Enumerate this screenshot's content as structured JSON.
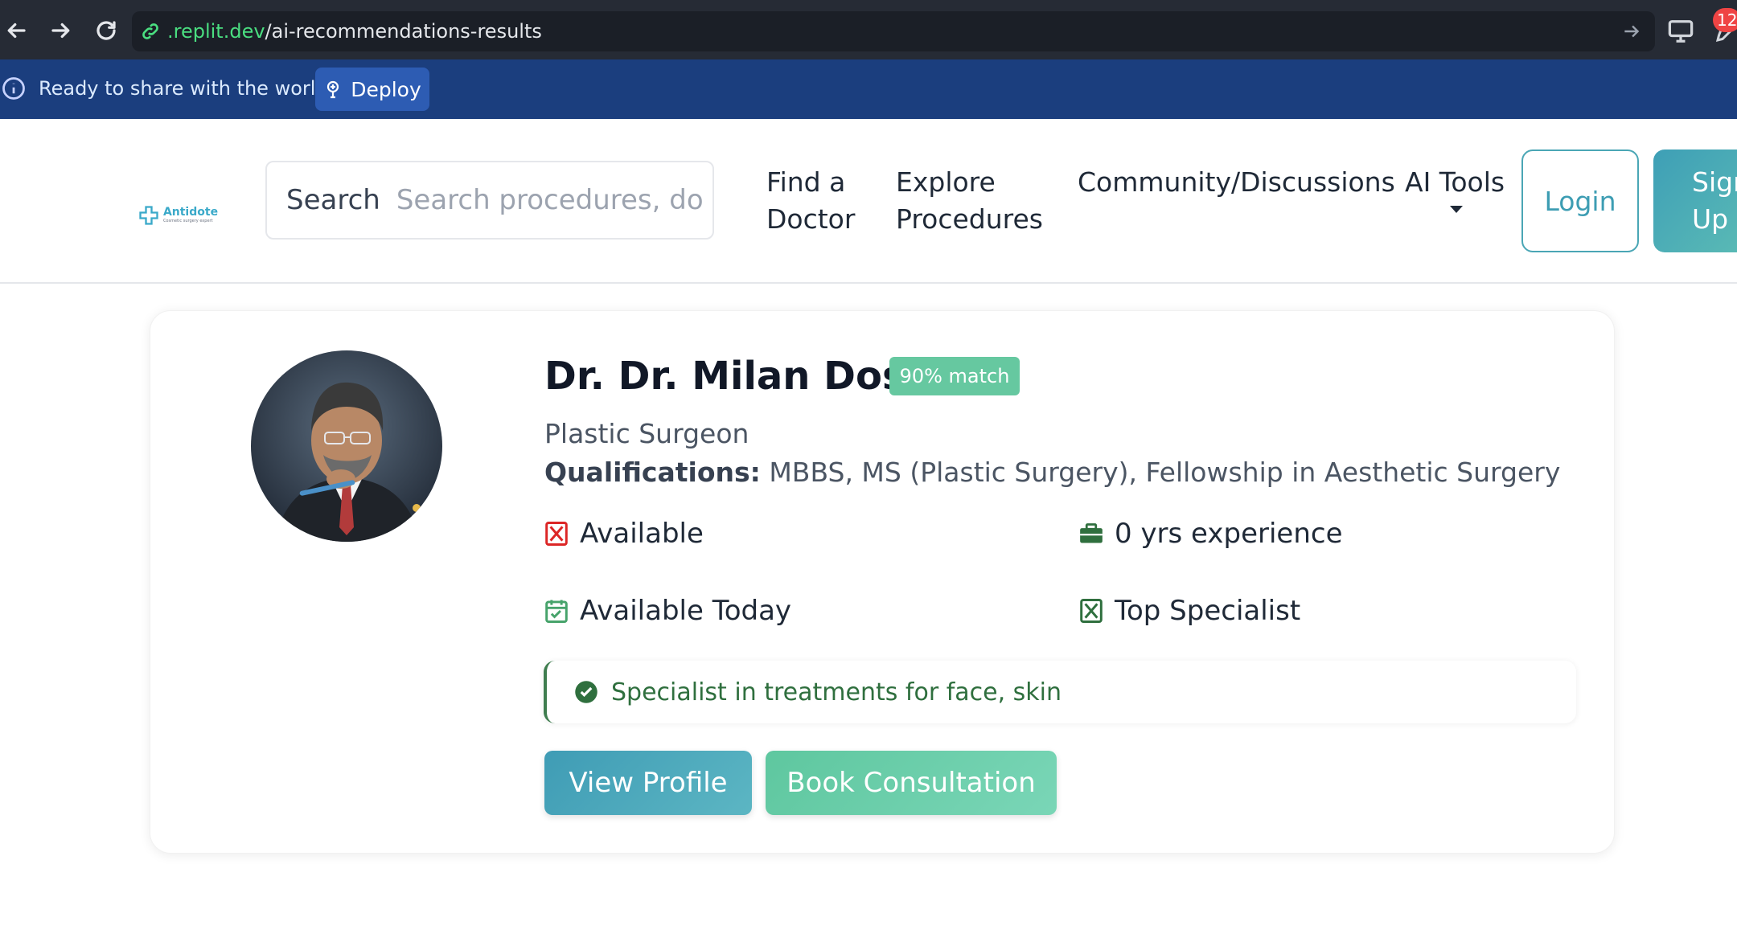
{
  "browser": {
    "url_host": ".replit.dev",
    "url_path": "/ai-recommendations-results",
    "extension_badge": "12"
  },
  "banner": {
    "text": "Ready to share with the world?",
    "deploy_label": "Deploy"
  },
  "header": {
    "logo_name": "Antidote",
    "logo_tagline": "Cosmetic surgery expert",
    "search_label": "Search",
    "search_placeholder": "Search procedures, doctors",
    "nav": {
      "find_doctor_line1": "Find a",
      "find_doctor_line2": "Doctor",
      "explore_line1": "Explore",
      "explore_line2": "Procedures",
      "community": "Community/Discussions",
      "ai_tools": "AI Tools"
    },
    "login_label": "Login",
    "signup_line1": "Sign",
    "signup_line2": "Up"
  },
  "doctor": {
    "name": "Dr. Dr. Milan Doshi",
    "match": "90% match",
    "specialty": "Plastic Surgeon",
    "qualifications_label": "Qualifications:",
    "qualifications": "MBBS, MS (Plastic Surgery), Fellowship in Aesthetic Surgery",
    "availability": "Available",
    "experience": "0 yrs experience",
    "available_today": "Available Today",
    "top_specialist": "Top Specialist",
    "specialist_note": "Specialist in treatments for face, skin",
    "view_profile": "View Profile",
    "book_consultation": "Book Consultation"
  },
  "colors": {
    "banner_bg": "#1b3e7e",
    "brand_teal": "#3d9db3",
    "match_green": "#66c8a0",
    "specialist_green": "#2f6f3e"
  }
}
